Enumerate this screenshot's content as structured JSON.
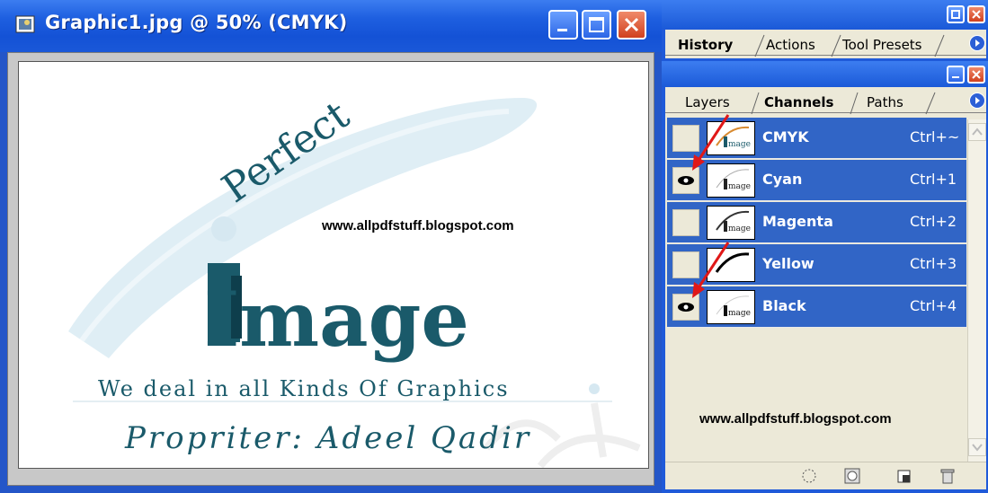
{
  "document": {
    "title": "Graphic1.jpg @ 50% (CMYK)",
    "watermark": "www.allpdfstuff.blogspot.com",
    "artwork": {
      "line1": "Perfect",
      "line2": "Image",
      "line3": "We deal in all Kinds Of Graphics",
      "line4": "Propriter: Adeel Qadir"
    }
  },
  "history_panel": {
    "tabs": [
      "History",
      "Actions",
      "Tool Presets"
    ],
    "active_tab": "History"
  },
  "channels_panel": {
    "tabs": [
      "Layers",
      "Channels",
      "Paths"
    ],
    "active_tab": "Channels",
    "channels": [
      {
        "name": "CMYK",
        "shortcut": "Ctrl+~",
        "visible": false
      },
      {
        "name": "Cyan",
        "shortcut": "Ctrl+1",
        "visible": true
      },
      {
        "name": "Magenta",
        "shortcut": "Ctrl+2",
        "visible": false
      },
      {
        "name": "Yellow",
        "shortcut": "Ctrl+3",
        "visible": false
      },
      {
        "name": "Black",
        "shortcut": "Ctrl+4",
        "visible": true
      }
    ],
    "watermark": "www.allpdfstuff.blogspot.com"
  },
  "colors": {
    "titlebar": "#1e5fe0",
    "selection": "#3165c6",
    "panel_bg": "#ece9d8",
    "logo_teal": "#1a5a6a",
    "annotation_red": "#e01818"
  },
  "icons": [
    "photoshop-doc-icon",
    "minimize-icon",
    "maximize-icon",
    "close-icon",
    "eye-icon",
    "panel-menu-icon",
    "load-selection-icon",
    "save-selection-icon",
    "new-channel-icon",
    "trash-icon"
  ]
}
